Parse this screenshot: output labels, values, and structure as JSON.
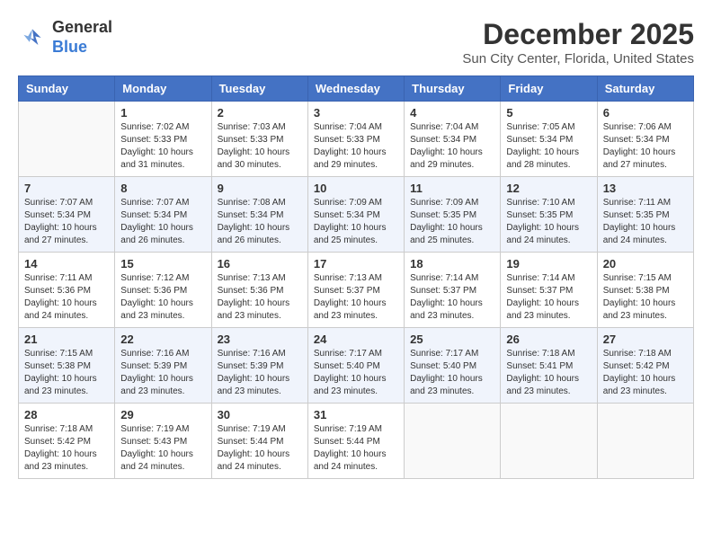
{
  "logo": {
    "general": "General",
    "blue": "Blue"
  },
  "title": "December 2025",
  "subtitle": "Sun City Center, Florida, United States",
  "weekdays": [
    "Sunday",
    "Monday",
    "Tuesday",
    "Wednesday",
    "Thursday",
    "Friday",
    "Saturday"
  ],
  "weeks": [
    [
      {
        "date": "",
        "info": ""
      },
      {
        "date": "1",
        "info": "Sunrise: 7:02 AM\nSunset: 5:33 PM\nDaylight: 10 hours\nand 31 minutes."
      },
      {
        "date": "2",
        "info": "Sunrise: 7:03 AM\nSunset: 5:33 PM\nDaylight: 10 hours\nand 30 minutes."
      },
      {
        "date": "3",
        "info": "Sunrise: 7:04 AM\nSunset: 5:33 PM\nDaylight: 10 hours\nand 29 minutes."
      },
      {
        "date": "4",
        "info": "Sunrise: 7:04 AM\nSunset: 5:34 PM\nDaylight: 10 hours\nand 29 minutes."
      },
      {
        "date": "5",
        "info": "Sunrise: 7:05 AM\nSunset: 5:34 PM\nDaylight: 10 hours\nand 28 minutes."
      },
      {
        "date": "6",
        "info": "Sunrise: 7:06 AM\nSunset: 5:34 PM\nDaylight: 10 hours\nand 27 minutes."
      }
    ],
    [
      {
        "date": "7",
        "info": "Sunrise: 7:07 AM\nSunset: 5:34 PM\nDaylight: 10 hours\nand 27 minutes."
      },
      {
        "date": "8",
        "info": "Sunrise: 7:07 AM\nSunset: 5:34 PM\nDaylight: 10 hours\nand 26 minutes."
      },
      {
        "date": "9",
        "info": "Sunrise: 7:08 AM\nSunset: 5:34 PM\nDaylight: 10 hours\nand 26 minutes."
      },
      {
        "date": "10",
        "info": "Sunrise: 7:09 AM\nSunset: 5:34 PM\nDaylight: 10 hours\nand 25 minutes."
      },
      {
        "date": "11",
        "info": "Sunrise: 7:09 AM\nSunset: 5:35 PM\nDaylight: 10 hours\nand 25 minutes."
      },
      {
        "date": "12",
        "info": "Sunrise: 7:10 AM\nSunset: 5:35 PM\nDaylight: 10 hours\nand 24 minutes."
      },
      {
        "date": "13",
        "info": "Sunrise: 7:11 AM\nSunset: 5:35 PM\nDaylight: 10 hours\nand 24 minutes."
      }
    ],
    [
      {
        "date": "14",
        "info": "Sunrise: 7:11 AM\nSunset: 5:36 PM\nDaylight: 10 hours\nand 24 minutes."
      },
      {
        "date": "15",
        "info": "Sunrise: 7:12 AM\nSunset: 5:36 PM\nDaylight: 10 hours\nand 23 minutes."
      },
      {
        "date": "16",
        "info": "Sunrise: 7:13 AM\nSunset: 5:36 PM\nDaylight: 10 hours\nand 23 minutes."
      },
      {
        "date": "17",
        "info": "Sunrise: 7:13 AM\nSunset: 5:37 PM\nDaylight: 10 hours\nand 23 minutes."
      },
      {
        "date": "18",
        "info": "Sunrise: 7:14 AM\nSunset: 5:37 PM\nDaylight: 10 hours\nand 23 minutes."
      },
      {
        "date": "19",
        "info": "Sunrise: 7:14 AM\nSunset: 5:37 PM\nDaylight: 10 hours\nand 23 minutes."
      },
      {
        "date": "20",
        "info": "Sunrise: 7:15 AM\nSunset: 5:38 PM\nDaylight: 10 hours\nand 23 minutes."
      }
    ],
    [
      {
        "date": "21",
        "info": "Sunrise: 7:15 AM\nSunset: 5:38 PM\nDaylight: 10 hours\nand 23 minutes."
      },
      {
        "date": "22",
        "info": "Sunrise: 7:16 AM\nSunset: 5:39 PM\nDaylight: 10 hours\nand 23 minutes."
      },
      {
        "date": "23",
        "info": "Sunrise: 7:16 AM\nSunset: 5:39 PM\nDaylight: 10 hours\nand 23 minutes."
      },
      {
        "date": "24",
        "info": "Sunrise: 7:17 AM\nSunset: 5:40 PM\nDaylight: 10 hours\nand 23 minutes."
      },
      {
        "date": "25",
        "info": "Sunrise: 7:17 AM\nSunset: 5:40 PM\nDaylight: 10 hours\nand 23 minutes."
      },
      {
        "date": "26",
        "info": "Sunrise: 7:18 AM\nSunset: 5:41 PM\nDaylight: 10 hours\nand 23 minutes."
      },
      {
        "date": "27",
        "info": "Sunrise: 7:18 AM\nSunset: 5:42 PM\nDaylight: 10 hours\nand 23 minutes."
      }
    ],
    [
      {
        "date": "28",
        "info": "Sunrise: 7:18 AM\nSunset: 5:42 PM\nDaylight: 10 hours\nand 23 minutes."
      },
      {
        "date": "29",
        "info": "Sunrise: 7:19 AM\nSunset: 5:43 PM\nDaylight: 10 hours\nand 24 minutes."
      },
      {
        "date": "30",
        "info": "Sunrise: 7:19 AM\nSunset: 5:44 PM\nDaylight: 10 hours\nand 24 minutes."
      },
      {
        "date": "31",
        "info": "Sunrise: 7:19 AM\nSunset: 5:44 PM\nDaylight: 10 hours\nand 24 minutes."
      },
      {
        "date": "",
        "info": ""
      },
      {
        "date": "",
        "info": ""
      },
      {
        "date": "",
        "info": ""
      }
    ]
  ]
}
